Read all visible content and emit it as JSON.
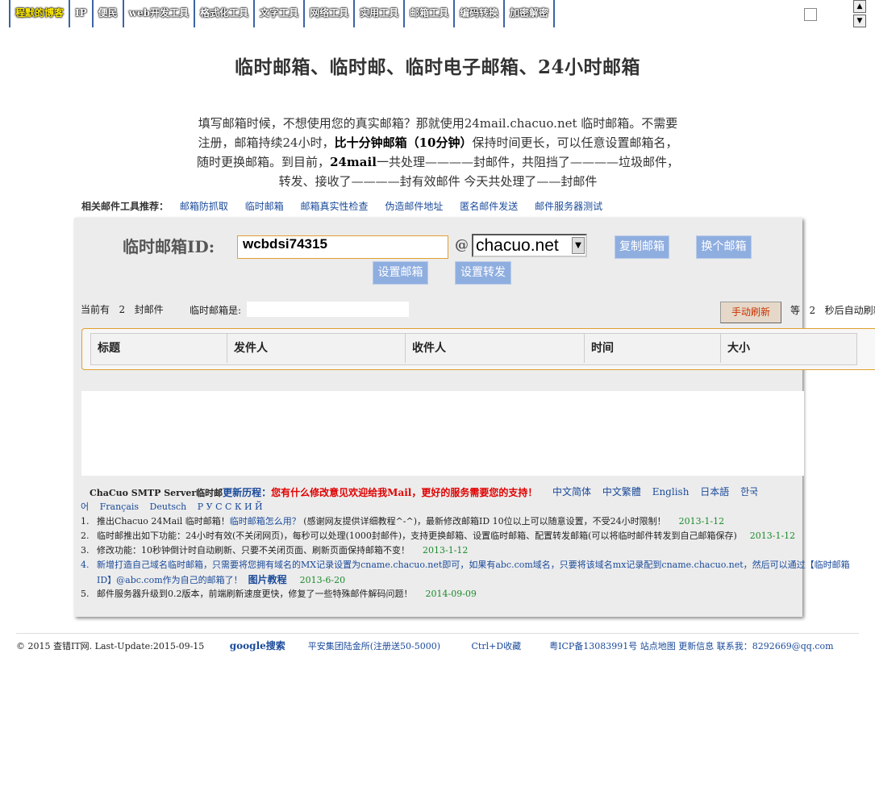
{
  "nav": [
    "程默的博客",
    "IP",
    "便民",
    "web开发工具",
    "格式化工具",
    "文字工具",
    "网络工具",
    "实用工具",
    "邮箱工具",
    "编码转换",
    "加密解密"
  ],
  "title": "临时邮箱、临时邮、临时电子邮箱、24小时邮箱",
  "intro": {
    "p1": "填写邮箱时候，不想使用您的真实邮箱？那就使用24mail.chacuo.net 临时邮箱。不需要注册，邮箱持续24小时，",
    "b1": "比十分钟邮箱（10分钟）",
    "p2": "保持时间更长，可以任意设置邮箱名，随时更换邮箱。到目前，",
    "b2": "24mail",
    "p3": "一共处理————封邮件，共阻挡了————垃圾邮件，转发、接收了————封有效邮件 今天共处理了——封邮件"
  },
  "related": {
    "label": "相关邮件工具推荐：",
    "links": [
      "邮箱防抓取",
      "临时邮箱",
      "邮箱真实性检查",
      "伪造邮件地址",
      "匿名邮件发送",
      "邮件服务器测试"
    ]
  },
  "panel": {
    "id_label": "临时邮箱ID:",
    "id_value": "wcbdsi74315",
    "at": "@",
    "domain": "chacuo.net",
    "copy_btn": "复制邮箱",
    "change_btn": "换个邮箱",
    "set_mail_btn": "设置邮箱",
    "set_fwd_btn": "设置转发",
    "count_prefix": "当前有",
    "count_value": "2",
    "count_suffix": "封邮件",
    "current_label": "临时邮箱是:",
    "refresh_btn": "手动刷新",
    "wait_prefix": "等",
    "wait_value": "2",
    "wait_suffix": "秒后自动刷新"
  },
  "table_headers": [
    "标题",
    "发件人",
    "收件人",
    "时间",
    "大小"
  ],
  "news": {
    "server": "ChaCuo SMTP Server",
    "mail": "临时邮",
    "history": "更新历程：",
    "ask": "您有什么修改意见欢迎给我Mail，更好的服务需要您的支持！",
    "languages": [
      "中文简体",
      "中文繁體",
      "English",
      "日本語",
      "한국"
    ],
    "languages2": [
      "어",
      "Français",
      "Deutsch",
      "Р У С С К И Й"
    ],
    "items": [
      {
        "num": "1.",
        "a": "推出Chacuo 24Mail 临时邮箱！",
        "link": "临时邮箱怎么用？",
        "b": " (感谢网友提供详细教程^-^)，最新修改邮箱ID 10位以上可以随意设置，不受24小时限制！",
        "date": "2013-1-12"
      },
      {
        "num": "2.",
        "a": "临时邮推出如下功能：24小时有效(不关闭网页)，每秒可以处理(1000封邮件)，支持更换邮箱、设置临时邮箱、配置转发邮箱(可以将临时邮件转发到自己邮箱保存)",
        "date": "2013-1-12"
      },
      {
        "num": "3.",
        "a": "修改功能：10秒钟倒计时自动刷新、只要不关闭页面、刷新页面保持邮箱不变！",
        "date": "2013-1-12"
      },
      {
        "num": "4.",
        "a": "新增打造自己域名临时邮箱，只需要将您拥有域名的MX记录设置为cname.chacuo.net即可，如果有abc.com域名，只要将该域名mx记录配到cname.chacuo.net，然后可以通过【临时邮箱",
        "cont": "ID】@abc.com作为自己的邮箱了！",
        "link": "图片教程",
        "date": "2013-6-20"
      },
      {
        "num": "5.",
        "a": "邮件服务器升级到0.2版本，前端刷新速度更快，修复了一些特殊邮件解码问题！",
        "date": "2014-09-09"
      }
    ]
  },
  "footer": {
    "copyright": "© 2015 查错IT网. Last-Update:2015-09-15",
    "google": "google搜索",
    "ad": "平安集团陆金所(注册送50-5000)",
    "fav": "Ctrl+D收藏",
    "icp": "粤ICP备13083991号 站点地图 更新信息 联系我：8292669@qq.com"
  }
}
